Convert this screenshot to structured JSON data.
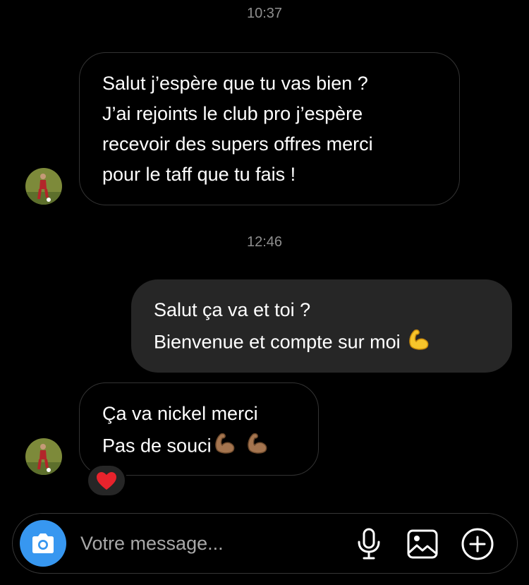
{
  "conversation": {
    "timestamps": [
      "10:37",
      "12:46"
    ],
    "messages": [
      {
        "direction": "incoming",
        "lines": [
          "Salut j’espère que tu vas bien ?",
          "J’ai rejoints le club pro j’espère",
          "recevoir des supers offres merci",
          "pour le taff que tu fais !"
        ]
      },
      {
        "direction": "outgoing",
        "lines": [
          "Salut ça va et toi ?",
          "Bienvenue et compte sur moi"
        ],
        "trailing_emoji": "flexed-biceps-icon"
      },
      {
        "direction": "incoming",
        "lines": [
          "Ça va nickel merci",
          "Pas de souci"
        ],
        "trailing_emoji": "flexed-biceps-medium-skin-icon",
        "trailing_emoji_count": 2,
        "reaction": "red-heart-icon"
      }
    ]
  },
  "composer": {
    "placeholder": "Votre message..."
  },
  "colors": {
    "background": "#000000",
    "incoming_border": "#333333",
    "outgoing_bubble": "#262626",
    "timestamp": "#8e8e8e",
    "camera_button": "#3797f0",
    "placeholder": "#a8a8a8"
  }
}
